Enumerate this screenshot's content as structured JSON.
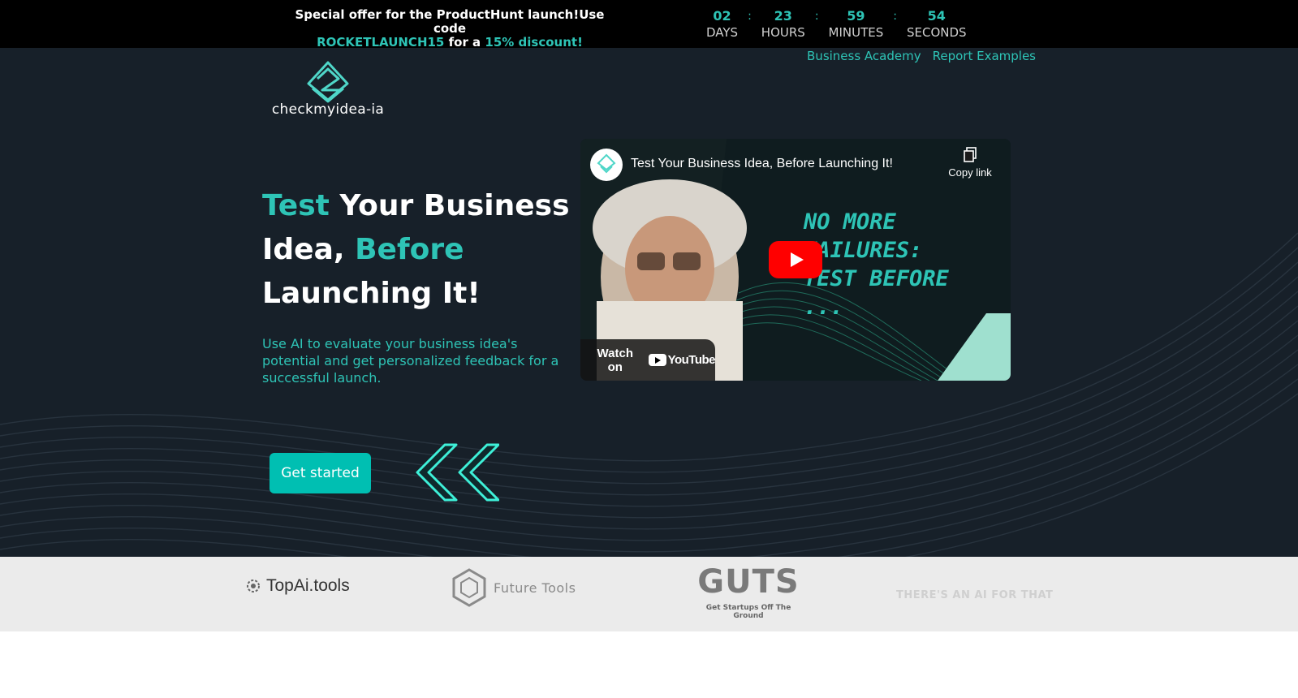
{
  "promo": {
    "line1": "Special offer for the ProductHunt launch!Use code",
    "code": "ROCKETLAUNCH15",
    "for_a": "for a",
    "discount": "15% discount!",
    "countdown": [
      {
        "value": "02",
        "label": "DAYS"
      },
      {
        "value": "23",
        "label": "HOURS"
      },
      {
        "value": "59",
        "label": "MINUTES"
      },
      {
        "value": "54",
        "label": "SECONDS"
      }
    ],
    "separator": ":"
  },
  "nav": {
    "items": [
      "Business Academy",
      "Report Examples"
    ]
  },
  "logo": {
    "text": "checkmyidea-ia"
  },
  "hero": {
    "w1": "Test",
    "w2": " Your Business Idea, ",
    "w3": "Before",
    "w4": " Launching It!",
    "subtitle": "Use AI to evaluate your business idea's potential and get personalized feedback for a successful launch.",
    "cta": "Get started"
  },
  "video": {
    "title": "Test Your Business Idea, Before Launching It!",
    "copy_link": "Copy link",
    "tag1": "NO MORE",
    "tag2": "FAILURES:",
    "tag3": "TEST BEFORE",
    "tag4": "...",
    "watch_on": "Watch on",
    "youtube": "YouTube",
    "watermark": "checkmyidea-ia"
  },
  "partners": {
    "items": [
      {
        "name": "TopAi.tools"
      },
      {
        "name": "Future Tools"
      },
      {
        "name": "GUTS",
        "sub": "Get Startups Off The Ground"
      },
      {
        "name": "THERE'S AN AI FOR THAT"
      }
    ]
  },
  "colors": {
    "accent": "#2ec4b6",
    "cta": "#00bfb2",
    "hero_bg": "#172029",
    "promo_bg": "#000000",
    "partners_bg": "#ebebeb"
  }
}
